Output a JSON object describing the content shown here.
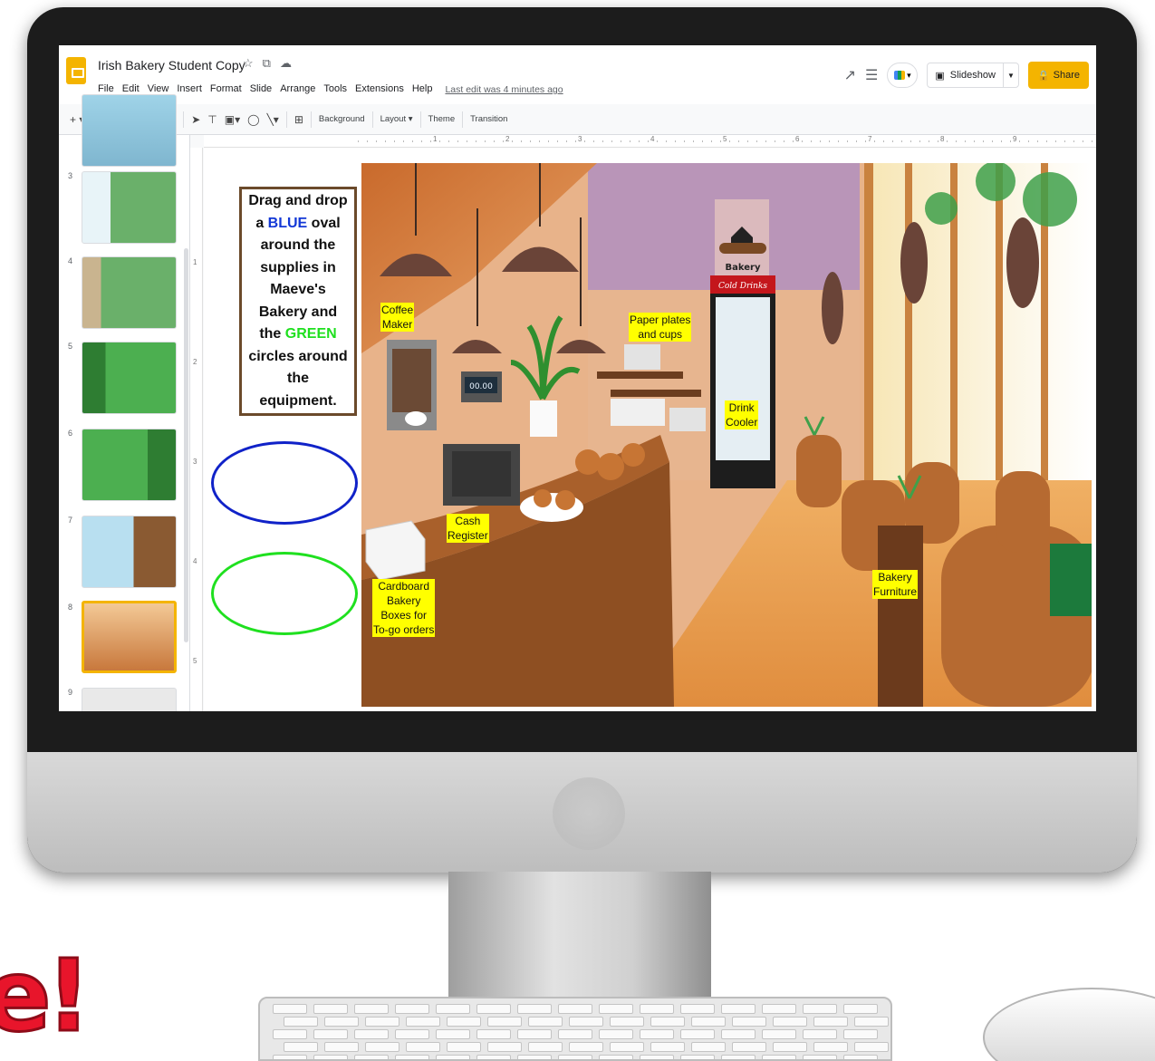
{
  "app": {
    "doc_title": "Irish Bakery Student Copy",
    "menu": [
      "File",
      "Edit",
      "View",
      "Insert",
      "Format",
      "Slide",
      "Arrange",
      "Tools",
      "Extensions",
      "Help"
    ],
    "last_edit": "Last edit was 4 minutes ago",
    "slideshow_label": "Slideshow",
    "share_label": "Share",
    "icons": {
      "logo": "slides-logo-icon",
      "star": "star-icon",
      "move": "move-to-folder-icon",
      "cloud": "cloud-status-icon",
      "activity": "activity-icon",
      "comments": "comments-icon",
      "meet": "meet-icon",
      "add": "add-icon",
      "undo": "undo-icon",
      "redo": "redo-icon",
      "print": "print-icon",
      "paint": "paint-format-icon",
      "zoom": "zoom-icon",
      "select": "select-icon",
      "textbox": "text-box-icon",
      "image": "image-icon",
      "shape": "shape-icon",
      "line": "line-icon",
      "comment": "comment-icon"
    }
  },
  "toolbar": {
    "background": "Background",
    "layout": "Layout",
    "theme": "Theme",
    "transition": "Transition"
  },
  "ruler": {
    "top_numbers": [
      "1",
      "2",
      "3",
      "4",
      "5",
      "6",
      "7",
      "8",
      "9"
    ],
    "left_numbers": [
      "1",
      "2",
      "3",
      "4",
      "5"
    ]
  },
  "filmstrip": {
    "slides": [
      {
        "number": "3",
        "selected": false
      },
      {
        "number": "4",
        "selected": false
      },
      {
        "number": "5",
        "selected": false
      },
      {
        "number": "6",
        "selected": false
      },
      {
        "number": "7",
        "selected": false
      },
      {
        "number": "8",
        "selected": true
      },
      {
        "number": "9",
        "selected": false
      }
    ]
  },
  "slide": {
    "instructions": {
      "line1": "Drag and drop",
      "line2a": "a ",
      "blue_word": "BLUE",
      "line2b": " oval",
      "line3": "around the",
      "line4": "supplies in",
      "line5": "Maeve's",
      "line6": "Bakery and",
      "line7a": "the ",
      "green_word": "GREEN",
      "line8": "circles around",
      "line9": "the",
      "line10": "equipment."
    },
    "ovals": [
      {
        "color": "#1022c8",
        "name": "blue"
      },
      {
        "color": "#1fe01f",
        "name": "green"
      }
    ],
    "labels": {
      "coffee": [
        "Coffee",
        "Maker"
      ],
      "paper": [
        "Paper plates",
        "and cups"
      ],
      "drink": [
        "Drink",
        "Cooler"
      ],
      "register": [
        "Cash",
        "Register"
      ],
      "boxes": [
        "Cardboard",
        "Bakery",
        "Boxes for",
        "To-go orders"
      ],
      "furniture": [
        "Bakery",
        "Furniture"
      ]
    },
    "scene_text": {
      "bakery_sign": "Bakery",
      "cold_drinks": "Cold Drinks",
      "register_display": "00.00"
    }
  },
  "colors": {
    "accent": "#f4b400",
    "highlight": "#ffff00"
  },
  "overlay_text": "e!"
}
